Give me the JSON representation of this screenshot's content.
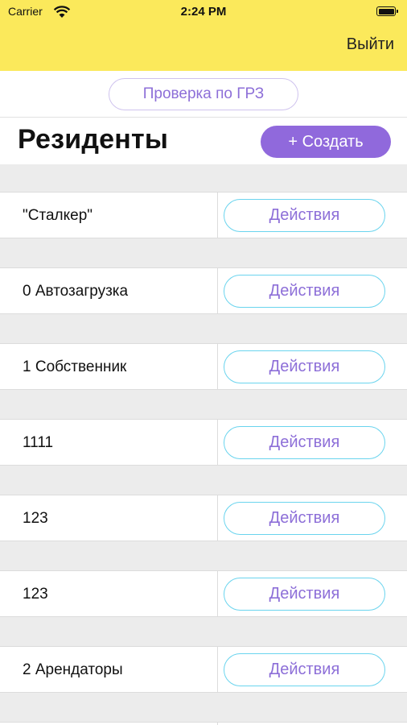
{
  "status_bar": {
    "carrier": "Carrier",
    "time": "2:24 PM"
  },
  "header": {
    "logout_label": "Выйти"
  },
  "grz_check_label": "Проверка по ГРЗ",
  "page_title": "Резиденты",
  "create_label": "+ Создать",
  "residents": [
    {
      "name": "\"Сталкер\"",
      "action_label": "Действия"
    },
    {
      "name": "0 Автозагрузка",
      "action_label": "Действия"
    },
    {
      "name": "1 Собственник",
      "action_label": "Действия"
    },
    {
      "name": "1111",
      "action_label": "Действия"
    },
    {
      "name": "123",
      "action_label": "Действия"
    },
    {
      "name": "123",
      "action_label": "Действия"
    },
    {
      "name": "2 Арендаторы",
      "action_label": "Действия"
    }
  ],
  "colors": {
    "header_bg": "#fbe95b",
    "accent": "#9069dc",
    "action_border": "#6ad4ee"
  }
}
